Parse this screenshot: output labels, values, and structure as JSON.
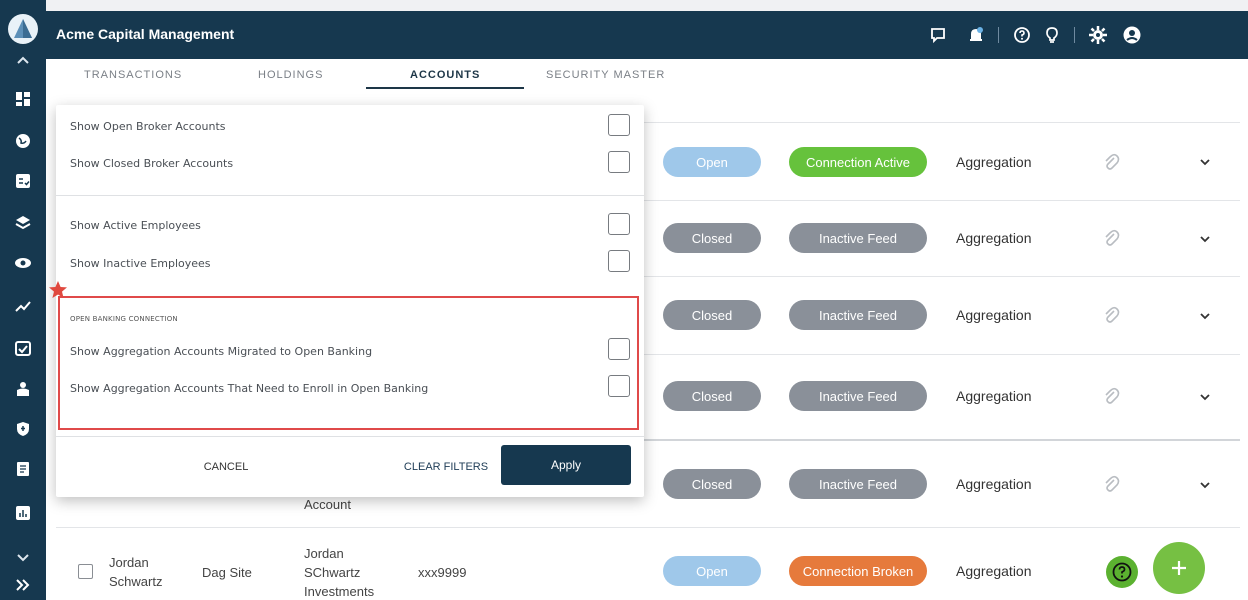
{
  "app": {
    "title": "Acme Capital Management"
  },
  "colors": {
    "nav": "#16384f",
    "open": "#9fc8ea",
    "closed": "#8a9099",
    "connection_active": "#66c23c",
    "connection_broken": "#e67a3c",
    "highlight_border": "#e04a4a",
    "fab": "#76c043"
  },
  "tabs": [
    {
      "label": "TRANSACTIONS"
    },
    {
      "label": "HOLDINGS"
    },
    {
      "label": "ACCOUNTS"
    },
    {
      "label": "SECURITY MASTER"
    }
  ],
  "filter": {
    "items": [
      {
        "label": "Show Open Broker Accounts"
      },
      {
        "label": "Show Closed Broker Accounts"
      },
      {
        "label": "Show Active Employees"
      },
      {
        "label": "Show Inactive Employees"
      }
    ],
    "open_banking": {
      "title": "OPEN BANKING CONNECTION",
      "items": [
        {
          "label": "Show Aggregation Accounts Migrated to Open Banking"
        },
        {
          "label": "Show Aggregation Accounts That Need to Enroll in Open Banking"
        }
      ]
    },
    "cancel_label": "CANCEL",
    "clear_label": "CLEAR FILTERS",
    "apply_label": "Apply"
  },
  "rows": [
    {
      "status": "Open",
      "connection": "Connection Active",
      "type": "Aggregation"
    },
    {
      "status": "Closed",
      "connection": "Inactive Feed",
      "type": "Aggregation"
    },
    {
      "status": "Closed",
      "connection": "Inactive Feed",
      "type": "Aggregation"
    },
    {
      "status": "Closed",
      "connection": "Inactive Feed",
      "type": "Aggregation"
    },
    {
      "status": "Closed",
      "connection": "Inactive Feed",
      "type": "Aggregation",
      "account_partial": "Account"
    },
    {
      "status": "Open",
      "connection": "Connection Broken",
      "type": "Aggregation",
      "name": "Jordan Schwartz",
      "site": "Dag Site",
      "account": "Jordan SChwartz Investments",
      "number": "xxx9999"
    }
  ],
  "icons": {
    "header": [
      "chat-icon",
      "notification-icon",
      "help-icon",
      "lightbulb-icon",
      "settings-icon",
      "user-icon"
    ],
    "sidebar": [
      "collapse-up-icon",
      "dashboard-icon",
      "globe-icon",
      "checklist-icon",
      "layers-icon",
      "eye-icon",
      "trend-icon",
      "calendar-check-icon",
      "user-card-icon",
      "shield-icon",
      "document-icon",
      "report-icon",
      "chevron-down-icon",
      "expand-icon"
    ],
    "fab": "plus-icon",
    "help_fab": "help-circle-icon"
  }
}
